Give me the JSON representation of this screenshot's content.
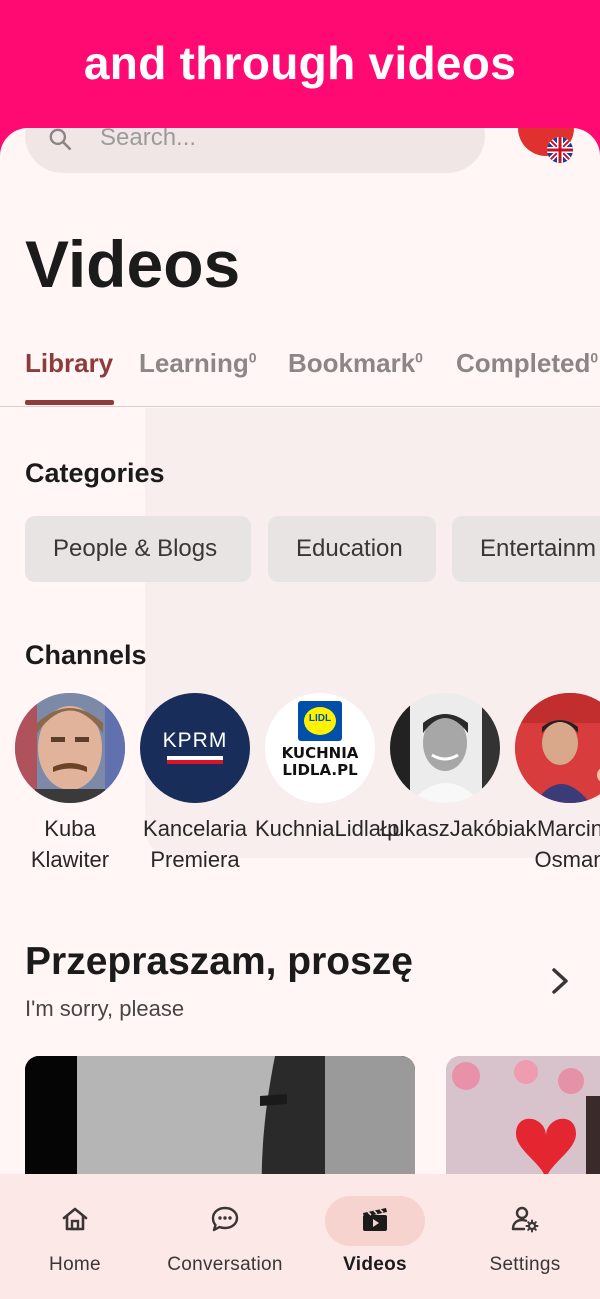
{
  "banner": {
    "title": "and through videos"
  },
  "search": {
    "placeholder": "Search..."
  },
  "page": {
    "title": "Videos"
  },
  "tabs": [
    {
      "label": "Library",
      "count": ""
    },
    {
      "label": "Learning",
      "count": "0"
    },
    {
      "label": "Bookmark",
      "count": "0"
    },
    {
      "label": "Completed",
      "count": "0"
    }
  ],
  "categories": {
    "title": "Categories",
    "items": [
      "People & Blogs",
      "Education",
      "Entertainm"
    ]
  },
  "channels": {
    "title": "Channels",
    "items": [
      {
        "name": "Kuba Klawiter"
      },
      {
        "name": "Kancelaria Premiera",
        "logo_text": "KPRM"
      },
      {
        "name": "KuchniaLidla.pl",
        "logo_text": "KUCHNIA LIDLA.PL",
        "badge": "LIDL"
      },
      {
        "name": "ŁukaszJakóbiak"
      },
      {
        "name": "Marcin Osman"
      }
    ]
  },
  "playlist": {
    "title": "Przepraszam, proszę",
    "subtitle": "I'm sorry, please"
  },
  "nav": {
    "items": [
      {
        "label": "Home",
        "icon": "home-icon"
      },
      {
        "label": "Conversation",
        "icon": "chat-icon"
      },
      {
        "label": "Videos",
        "icon": "clapperboard-icon"
      },
      {
        "label": "Settings",
        "icon": "user-settings-icon"
      }
    ],
    "active": "Videos"
  },
  "colors": {
    "banner": "#FF0A73",
    "accent": "#8E3B3B",
    "background": "#FFF6F5",
    "nav_background": "#FCE8E6",
    "nav_active_pill": "#F7D3D0"
  }
}
